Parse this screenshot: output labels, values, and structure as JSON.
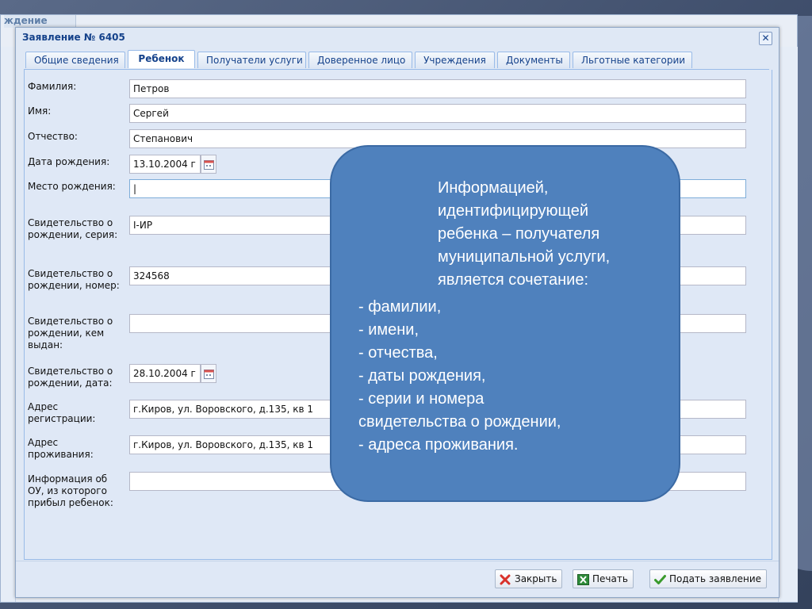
{
  "background_window": {
    "title": "ждение"
  },
  "dialog": {
    "title": "Заявление № 6405",
    "close_symbol": "✕",
    "tabs": [
      {
        "label": "Общие сведения",
        "active": false
      },
      {
        "label": "Ребенок",
        "active": true
      },
      {
        "label": "Получатели услуги",
        "active": false
      },
      {
        "label": "Доверенное лицо",
        "active": false
      },
      {
        "label": "Учреждения",
        "active": false
      },
      {
        "label": "Документы",
        "active": false
      },
      {
        "label": "Льготные категории",
        "active": false
      }
    ],
    "fields": {
      "last_name": {
        "label": "Фамилия:",
        "value": "Петров"
      },
      "first_name": {
        "label": "Имя:",
        "value": "Сергей"
      },
      "patronymic": {
        "label": "Отчество:",
        "value": "Степанович"
      },
      "birth_date": {
        "label": "Дата рождения:",
        "value": "13.10.2004 г"
      },
      "birth_place": {
        "label": "Место рождения:",
        "value": "|"
      },
      "cert_series": {
        "label": "Свидетельство о рождении, серия:",
        "value": "I-ИР"
      },
      "cert_number": {
        "label": "Свидетельство о рождении, номер:",
        "value": "324568"
      },
      "cert_issued_by": {
        "label": "Свидетельство о рождении, кем выдан:",
        "value": ""
      },
      "cert_date": {
        "label": "Свидетельство о рождении, дата:",
        "value": "28.10.2004 г"
      },
      "reg_address": {
        "label": "Адрес регистрации:",
        "value": "г.Киров, ул. Воровского, д.135, кв 1"
      },
      "live_address": {
        "label": "Адрес проживания:",
        "value": "г.Киров, ул. Воровского, д.135, кв 1"
      },
      "prev_school": {
        "label": "Информация об ОУ, из которого прибыл ребенок:",
        "value": ""
      }
    },
    "buttons": {
      "close": "Закрыть",
      "print": "Печать",
      "submit": "Подать заявление"
    }
  },
  "callout": {
    "heading_lines": [
      "Информацией,",
      "идентифицирующей",
      "ребенка – получателя",
      "муниципальной услуги,",
      "является сочетание:"
    ],
    "list_lines": [
      "- фамилии,",
      "- имени,",
      "- отчества,",
      "- даты рождения,",
      "- серии и номера",
      "свидетельства о рождении,",
      "- адреса проживания."
    ]
  },
  "colors": {
    "callout_fill": "#4f81bd",
    "title_text": "#15428b",
    "panel_bg": "#dfe8f6"
  }
}
